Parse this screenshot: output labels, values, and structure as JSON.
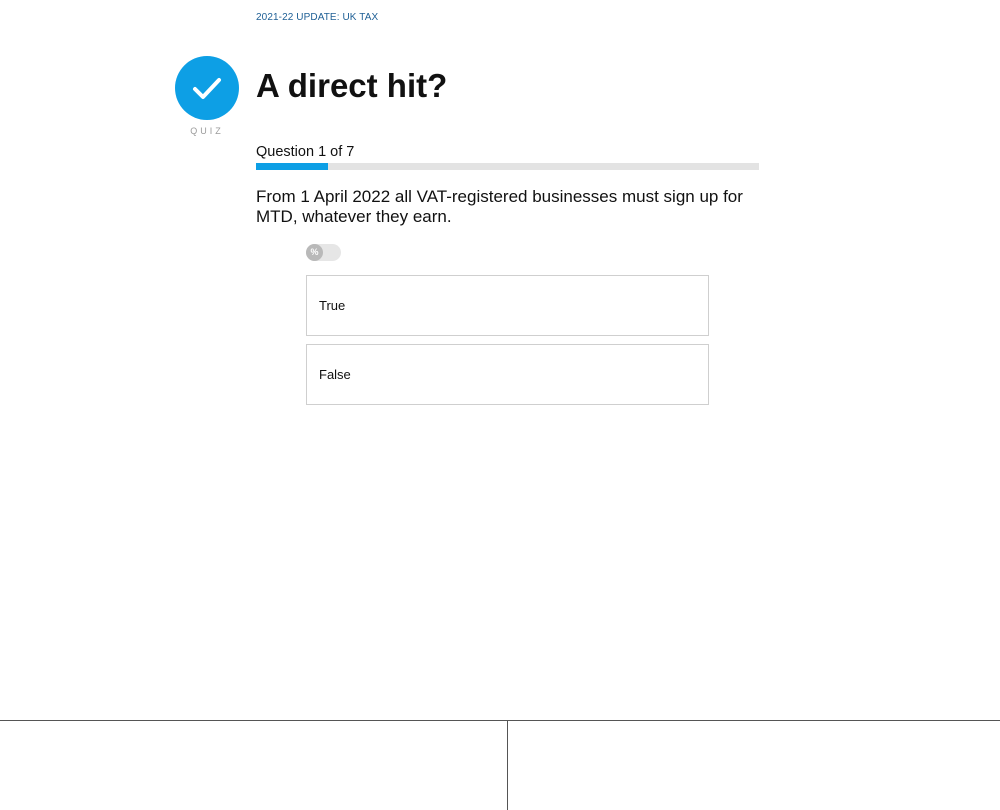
{
  "header": {
    "breadcrumb": "2021-22 UPDATE: UK TAX"
  },
  "badge": {
    "icon": "checkmark-icon",
    "label": "QUIZ",
    "color": "#0d9fe5"
  },
  "quiz": {
    "title": "A direct hit?",
    "progress_label": "Question 1 of 7",
    "progress_fraction": 0.143,
    "question": "From 1 April 2022 all VAT-registered businesses must sign up for MTD, whatever they earn.",
    "percent_toggle": {
      "symbol": "%",
      "on": false
    },
    "options": [
      {
        "label": "True"
      },
      {
        "label": "False"
      }
    ]
  },
  "colors": {
    "accent": "#0d9fe5",
    "breadcrumb": "#1e5f95",
    "track": "#e3e3e3"
  }
}
